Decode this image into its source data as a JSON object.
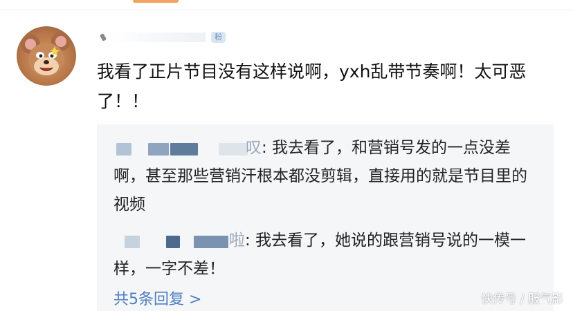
{
  "comment": {
    "badge": "粉",
    "text": "我看了正片节目没有这样说啊，yxh乱带节奏啊！太可恶了！！"
  },
  "replies": [
    {
      "name_tail": "叹",
      "text": ": 我去看了，和营销号发的一点没差啊，甚至那些营销汗根本都没剪辑，直接用的就是节目里的视频"
    },
    {
      "name_tail": "啦",
      "text": ": 我去看了，她说的跟营销号说的一模一样，一字不差！"
    }
  ],
  "more_replies": "共5条回复 >",
  "watermark": "快传号 / 服气影",
  "colors": {
    "link": "#4e7fc0",
    "reply_bg": "#f5f6f8",
    "badge_bg": "#d8e6f4"
  }
}
